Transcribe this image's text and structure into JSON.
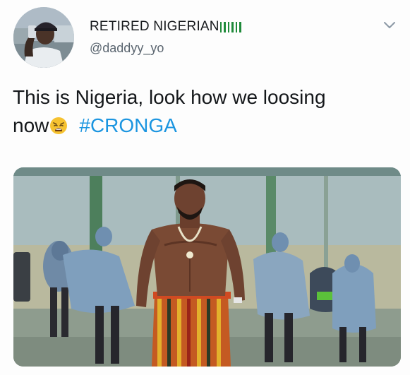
{
  "user": {
    "display_name": "RETIRED NIGERIAN",
    "handle": "@daddyy_yo"
  },
  "tweet": {
    "text_line1": "This is Nigeria, look how we loosing",
    "text_line2_prefix": "now",
    "emoji": "weary-face",
    "hashtag": "#CRONGA"
  },
  "icons": {
    "menu": "chevron-down-icon",
    "flag": "nigeria-flag-icon"
  },
  "colors": {
    "link": "#1b95e0",
    "flag_green": "#1f8a3a",
    "handle_gray": "#5b6670"
  }
}
